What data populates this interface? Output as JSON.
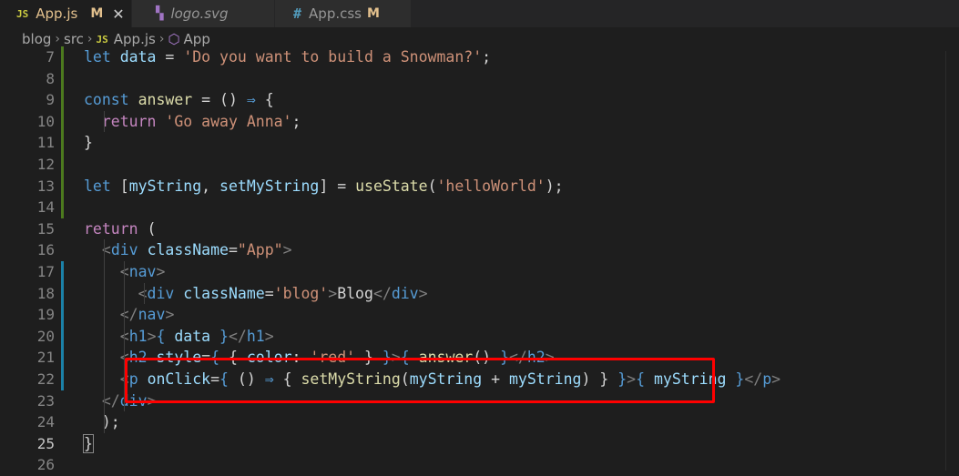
{
  "tabs": [
    {
      "badge": "JS",
      "label": "App.js",
      "modified": "M",
      "close": "✕"
    },
    {
      "label": "logo.svg"
    },
    {
      "badge": "#",
      "label": "App.css",
      "modified": "M"
    }
  ],
  "breadcrumb": {
    "parts": [
      "blog",
      "src",
      "App.js",
      "App"
    ],
    "js_badge": "JS"
  },
  "editor": {
    "current_line": 25,
    "lines": [
      {
        "n": "7",
        "tokens": [
          [
            "kw",
            "let "
          ],
          [
            "var",
            "data"
          ],
          [
            "op",
            " = "
          ],
          [
            "str",
            "'Do you want to build a Snowman?'"
          ],
          [
            "op",
            ";"
          ]
        ]
      },
      {
        "n": "8",
        "tokens": []
      },
      {
        "n": "9",
        "tokens": [
          [
            "kw",
            "const "
          ],
          [
            "fn",
            "answer"
          ],
          [
            "op",
            " = () "
          ],
          [
            "kw",
            "⇒"
          ],
          [
            "op",
            " {"
          ]
        ]
      },
      {
        "n": "10",
        "tokens": [
          [
            "op",
            "  "
          ],
          [
            "ctl",
            "return "
          ],
          [
            "str",
            "'Go away Anna'"
          ],
          [
            "op",
            ";"
          ]
        ]
      },
      {
        "n": "11",
        "tokens": [
          [
            "op",
            "}"
          ]
        ]
      },
      {
        "n": "12",
        "tokens": []
      },
      {
        "n": "13",
        "tokens": [
          [
            "kw",
            "let "
          ],
          [
            "op",
            "["
          ],
          [
            "var",
            "myString"
          ],
          [
            "op",
            ", "
          ],
          [
            "var",
            "setMyString"
          ],
          [
            "op",
            "] = "
          ],
          [
            "fn",
            "useState"
          ],
          [
            "op",
            "("
          ],
          [
            "str",
            "'helloWorld'"
          ],
          [
            "op",
            ");"
          ]
        ]
      },
      {
        "n": "14",
        "tokens": []
      },
      {
        "n": "15",
        "tokens": [
          [
            "ctl",
            "return "
          ],
          [
            "op",
            "("
          ]
        ]
      },
      {
        "n": "16",
        "tokens": [
          [
            "op",
            "  "
          ],
          [
            "brk",
            "<"
          ],
          [
            "tag",
            "div "
          ],
          [
            "var",
            "className"
          ],
          [
            "op",
            "="
          ],
          [
            "str",
            "\"App\""
          ],
          [
            "brk",
            ">"
          ]
        ]
      },
      {
        "n": "17",
        "tokens": [
          [
            "op",
            "    "
          ],
          [
            "brk",
            "<"
          ],
          [
            "tag",
            "nav"
          ],
          [
            "brk",
            ">"
          ]
        ]
      },
      {
        "n": "18",
        "tokens": [
          [
            "op",
            "      "
          ],
          [
            "brk",
            "<"
          ],
          [
            "tag",
            "div "
          ],
          [
            "var",
            "className"
          ],
          [
            "op",
            "="
          ],
          [
            "str",
            "'blog'"
          ],
          [
            "brk",
            ">"
          ],
          [
            "op",
            "Blog"
          ],
          [
            "brk",
            "</"
          ],
          [
            "tag",
            "div"
          ],
          [
            "brk",
            ">"
          ]
        ]
      },
      {
        "n": "19",
        "tokens": [
          [
            "op",
            "    "
          ],
          [
            "brk",
            "</"
          ],
          [
            "tag",
            "nav"
          ],
          [
            "brk",
            ">"
          ]
        ]
      },
      {
        "n": "20",
        "tokens": [
          [
            "op",
            "    "
          ],
          [
            "brk",
            "<"
          ],
          [
            "tag",
            "h1"
          ],
          [
            "brk",
            ">"
          ],
          [
            "jsxb",
            "{ "
          ],
          [
            "var",
            "data"
          ],
          [
            "jsxb",
            " }"
          ],
          [
            "brk",
            "</"
          ],
          [
            "tag",
            "h1"
          ],
          [
            "brk",
            ">"
          ]
        ]
      },
      {
        "n": "21",
        "tokens": [
          [
            "op",
            "    "
          ],
          [
            "brk",
            "<"
          ],
          [
            "tag",
            "h2 "
          ],
          [
            "var",
            "style"
          ],
          [
            "op",
            "="
          ],
          [
            "jsxb",
            "{ "
          ],
          [
            "op",
            "{ "
          ],
          [
            "var",
            "color"
          ],
          [
            "op",
            ": "
          ],
          [
            "str",
            "'red'"
          ],
          [
            "op",
            " } "
          ],
          [
            "jsxb",
            "}"
          ],
          [
            "brk",
            ">"
          ],
          [
            "jsxb",
            "{ "
          ],
          [
            "fn",
            "answer"
          ],
          [
            "op",
            "() "
          ],
          [
            "jsxb",
            "}"
          ],
          [
            "brk",
            "</"
          ],
          [
            "tag",
            "h2"
          ],
          [
            "brk",
            ">"
          ]
        ]
      },
      {
        "n": "22",
        "tokens": [
          [
            "op",
            "    "
          ],
          [
            "brk",
            "<"
          ],
          [
            "tag",
            "p "
          ],
          [
            "var",
            "onClick"
          ],
          [
            "op",
            "="
          ],
          [
            "jsxb",
            "{ "
          ],
          [
            "op",
            "() "
          ],
          [
            "kw",
            "⇒"
          ],
          [
            "op",
            " { "
          ],
          [
            "fn",
            "setMyString"
          ],
          [
            "op",
            "("
          ],
          [
            "var",
            "myString"
          ],
          [
            "op",
            " + "
          ],
          [
            "var",
            "myString"
          ],
          [
            "op",
            ") } "
          ],
          [
            "jsxb",
            "}"
          ],
          [
            "brk",
            ">"
          ],
          [
            "jsxb",
            "{ "
          ],
          [
            "var",
            "myString"
          ],
          [
            "jsxb",
            " }"
          ],
          [
            "brk",
            "</"
          ],
          [
            "tag",
            "p"
          ],
          [
            "brk",
            ">"
          ]
        ]
      },
      {
        "n": "23",
        "tokens": [
          [
            "op",
            "  "
          ],
          [
            "brk",
            "</"
          ],
          [
            "tag",
            "div"
          ],
          [
            "brk",
            ">"
          ]
        ]
      },
      {
        "n": "24",
        "tokens": [
          [
            "op",
            "  );"
          ]
        ]
      },
      {
        "n": "25",
        "tokens": [
          [
            "cur",
            "}"
          ]
        ]
      },
      {
        "n": "26",
        "tokens": []
      }
    ]
  },
  "colors": {
    "gutter_modified": "#4c7a1e",
    "gutter_added": "#1b81a8",
    "highlight": "#ff0000"
  }
}
